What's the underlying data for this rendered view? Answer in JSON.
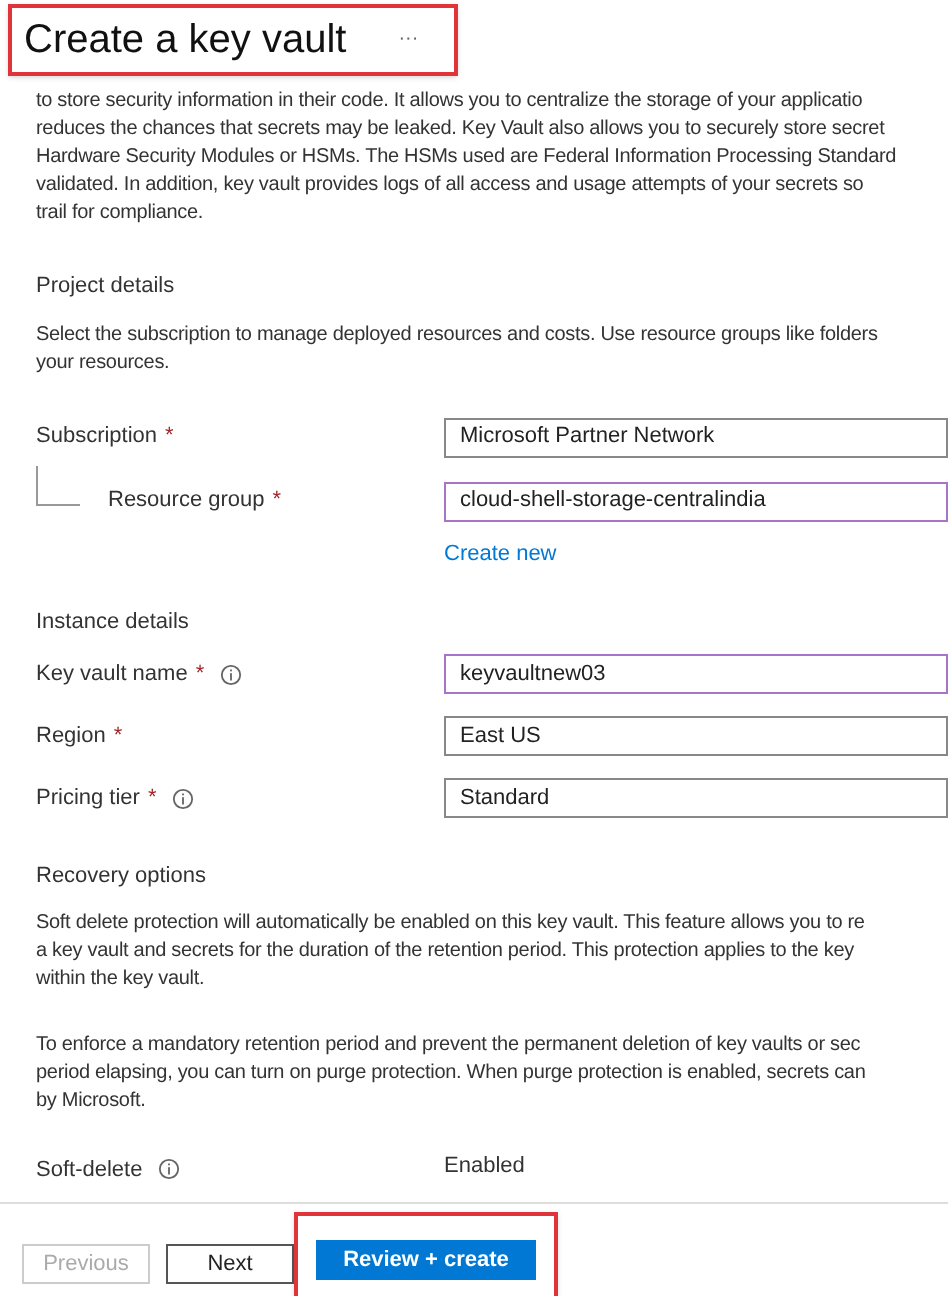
{
  "title": "Create a key vault",
  "more_button": "···",
  "intro_lines": [
    "to store security information in their code. It allows you to centralize the storage of your applicatio",
    "reduces the chances that secrets may be leaked. Key Vault also allows you to securely store secret",
    "Hardware Security Modules or HSMs. The HSMs used are Federal Information Processing Standard",
    "validated. In addition, key vault provides logs of all access and usage attempts of your secrets so",
    "trail for compliance."
  ],
  "project_details": {
    "heading": "Project details",
    "description_lines": [
      "Select the subscription to manage deployed resources and costs. Use resource groups like folders",
      "your resources."
    ],
    "subscription": {
      "label": "Subscription",
      "required": "*",
      "value": "Microsoft Partner Network",
      "focused": false
    },
    "resource_group": {
      "label": "Resource group",
      "required": "*",
      "value": "cloud-shell-storage-centralindia",
      "focused": true,
      "link": "Create new"
    }
  },
  "instance_details": {
    "heading": "Instance details",
    "fields": [
      {
        "label": "Key vault name",
        "required": "*",
        "info": true,
        "value": "keyvaultnew03",
        "focused": true
      },
      {
        "label": "Region",
        "required": "*",
        "info": false,
        "value": "East US",
        "focused": false
      },
      {
        "label": "Pricing tier",
        "required": "*",
        "info": true,
        "value": "Standard",
        "focused": false
      }
    ]
  },
  "recovery_options": {
    "heading": "Recovery options",
    "paragraphs": [
      [
        "Soft delete protection will automatically be enabled on this key vault. This feature allows you to re",
        "a key vault and secrets for the duration of the retention period. This protection applies to the key",
        "within the key vault."
      ],
      [
        "To enforce a mandatory retention period and prevent the permanent deletion of key vaults or sec",
        "period elapsing, you can turn on purge protection. When purge protection is enabled, secrets can",
        "by Microsoft."
      ]
    ],
    "soft_delete": {
      "label": "Soft-delete",
      "info": true,
      "value": "Enabled"
    }
  },
  "footer_buttons": [
    {
      "label": "Previous",
      "kind": "secondary",
      "disabled": true,
      "highlighted": false
    },
    {
      "label": "Next",
      "kind": "secondary",
      "disabled": false,
      "highlighted": false
    },
    {
      "label": "Review + create",
      "kind": "primary",
      "disabled": false,
      "highlighted": true
    }
  ]
}
